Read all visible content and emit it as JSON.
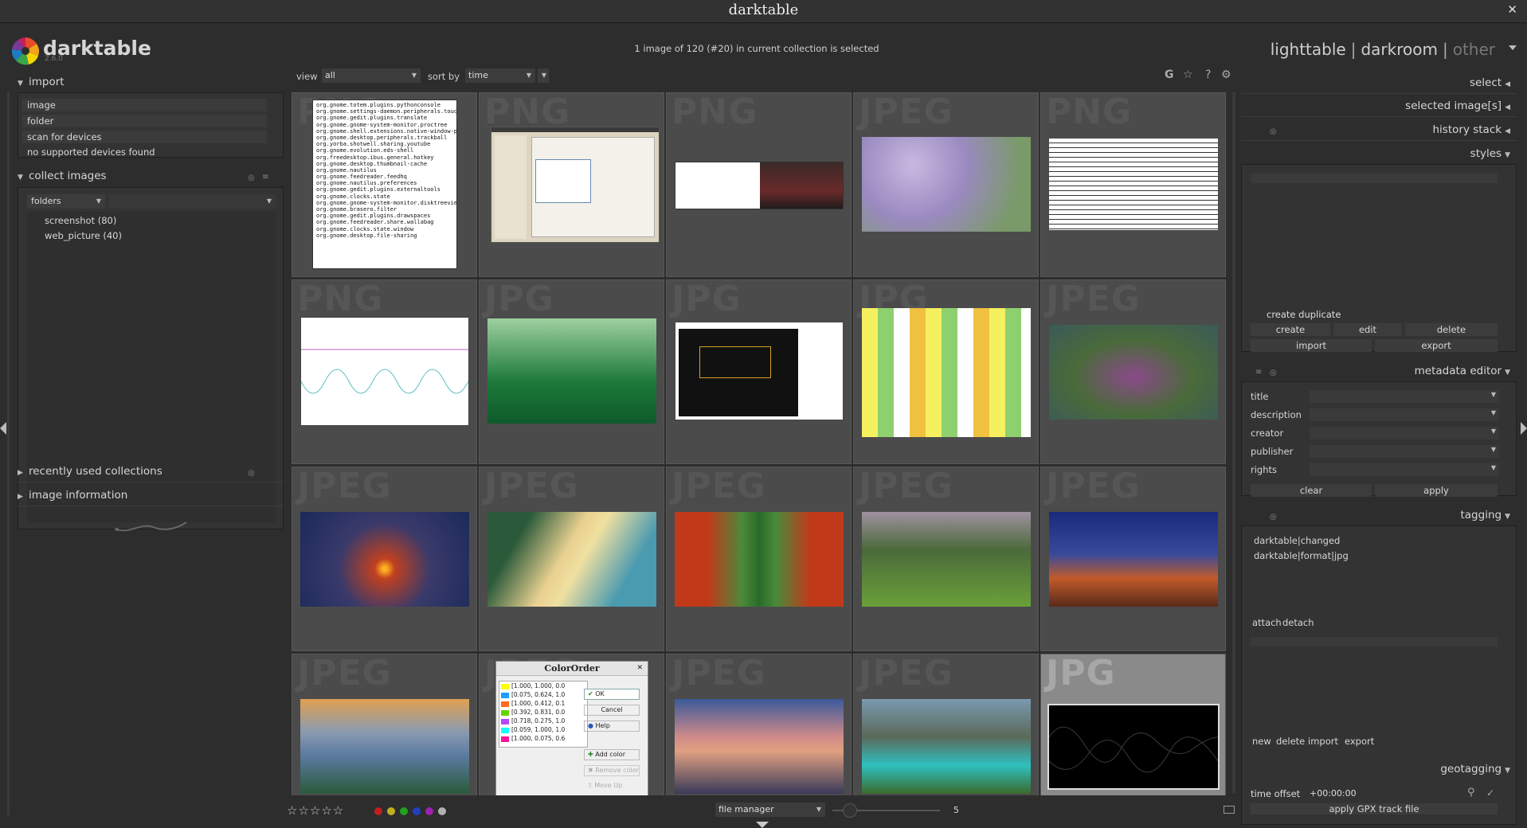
{
  "window": {
    "title": "darktable",
    "close": "✕"
  },
  "app": {
    "name": "darktable",
    "version": "2.6.0"
  },
  "header": {
    "selection_info": "1 image of 120 (#20) in current collection is selected"
  },
  "views": {
    "lighttable": "lighttable",
    "darkroom": "darkroom",
    "other": "other",
    "separator": "|"
  },
  "left": {
    "import": {
      "title": "import",
      "items": [
        "image",
        "folder",
        "scan for devices"
      ],
      "note": "no supported devices found"
    },
    "collect": {
      "title": "collect images",
      "property": "folders",
      "folders": [
        "screenshot (80)",
        "web_picture (40)"
      ]
    },
    "recent": {
      "title": "recently used collections"
    },
    "info": {
      "title": "image information"
    }
  },
  "toolbar": {
    "view_label": "view",
    "view_value": "all",
    "sort_label": "sort by",
    "sort_value": "time",
    "icons": [
      "G",
      "☆",
      "?",
      "⚙"
    ]
  },
  "grid": {
    "cells": [
      {
        "ext": "PNG"
      },
      {
        "ext": "PNG"
      },
      {
        "ext": "PNG"
      },
      {
        "ext": "JPEG"
      },
      {
        "ext": "PNG"
      },
      {
        "ext": "PNG"
      },
      {
        "ext": "JPG"
      },
      {
        "ext": "JPG"
      },
      {
        "ext": "JPG"
      },
      {
        "ext": "JPEG"
      },
      {
        "ext": "JPEG"
      },
      {
        "ext": "JPEG"
      },
      {
        "ext": "JPEG"
      },
      {
        "ext": "JPEG"
      },
      {
        "ext": "JPEG"
      },
      {
        "ext": "JPEG"
      },
      {
        "ext": "JPEG"
      },
      {
        "ext": "JPEG"
      },
      {
        "ext": "JPEG"
      },
      {
        "ext": "JPG"
      }
    ],
    "terminal_lines": [
      "org.gnome.totem.plugins.pythonconsole",
      "org.gnome.settings-daemon.peripherals.touch",
      "org.gnome.gedit.plugins.translate",
      "org.gnome.gnome-system-monitor.proctree",
      "org.gnome.shell.extensions.native-window-p",
      "org.gnome.desktop.peripherals.trackball",
      "org.yorba.shotwell.sharing.youtube",
      "org.gnome.evolution.eds-shell",
      "org.freedesktop.ibus.general.hotkey",
      "org.gnome.desktop.thumbnail-cache",
      "org.gnome.nautilus",
      "org.gnome.feedreader.feedhq",
      "org.gnome.nautilus.preferences",
      "org.gnome.gedit.plugins.externaltools",
      "org.gnome.clocks.state",
      "org.gnome.gnome-system-monitor.disktreeview",
      "org.gnome.brasero.filter",
      "org.gnome.gedit.plugins.drawspaces",
      "org.gnome.feedreader.share.wallabag",
      "org.gnome.clocks.state.window",
      "org.gnome.desktop.file-sharing"
    ],
    "dialog": {
      "title": "ColorOrder",
      "rows": [
        "[1.000, 1.000, 0.0",
        "[0.075, 0.624, 1.0",
        "[1.000, 0.412, 0.1",
        "[0.392, 0.831, 0.0",
        "[0.718, 0.275, 1.0",
        "[0.059, 1.000, 1.0",
        "[1.000, 0.075, 0.6"
      ],
      "ok": "OK",
      "cancel": "Cancel",
      "help": "Help",
      "add": "Add color",
      "remove": "Remove color",
      "moveup": "Move Up"
    }
  },
  "bottom": {
    "stars": "☆☆☆☆☆",
    "labels": [
      "#c02020",
      "#c0b020",
      "#20a020",
      "#2040c0",
      "#a020b0",
      "#b0b0b0"
    ],
    "layout": "file manager",
    "zoom": "5"
  },
  "right": {
    "select": "select",
    "selected": "selected image[s]",
    "history": "history stack",
    "styles": {
      "title": "styles",
      "create_duplicate": "create duplicate",
      "create": "create",
      "edit": "edit",
      "delete": "delete",
      "import": "import",
      "export": "export"
    },
    "metadata": {
      "title": "metadata editor",
      "fields": [
        "title",
        "description",
        "creator",
        "publisher",
        "rights"
      ],
      "clear": "clear",
      "apply": "apply"
    },
    "tagging": {
      "title": "tagging",
      "attached": [
        "darktable|changed",
        "darktable|format|jpg"
      ],
      "attach": "attach",
      "detach": "detach",
      "new": "new",
      "delete": "delete",
      "import": "import",
      "export": "export"
    },
    "geotagging": {
      "title": "geotagging",
      "offset_label": "time offset",
      "offset_value": "+00:00:00",
      "gpx": "apply GPX track file"
    }
  }
}
